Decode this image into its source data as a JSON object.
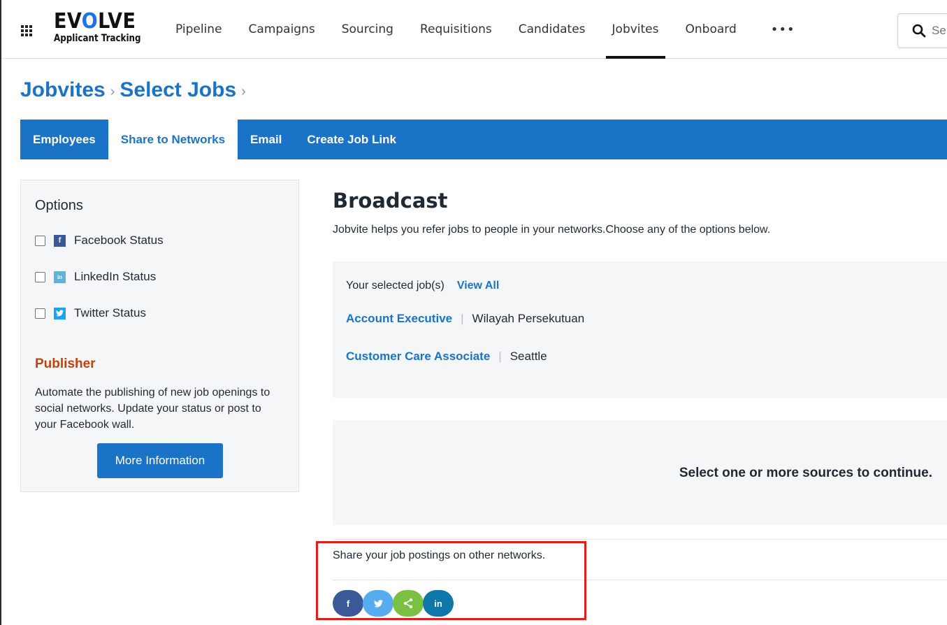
{
  "app": {
    "logo_text": "EVOLVE",
    "logo_subtitle": "Applicant Tracking"
  },
  "nav": {
    "items": [
      "Pipeline",
      "Campaigns",
      "Sourcing",
      "Requisitions",
      "Candidates",
      "Jobvites",
      "Onboard"
    ],
    "active": "Jobvites",
    "more_label": "•••",
    "search_placeholder": "Se"
  },
  "breadcrumb": {
    "items": [
      "Jobvites",
      "Select Jobs"
    ],
    "separator": "›"
  },
  "tabs": {
    "items": [
      "Employees",
      "Share to Networks",
      "Email",
      "Create Job Link"
    ],
    "active": "Share to Networks"
  },
  "options": {
    "title": "Options",
    "items": [
      {
        "label": "Facebook Status",
        "icon": "facebook-icon",
        "color": "#3b5998",
        "glyph": "f"
      },
      {
        "label": "LinkedIn Status",
        "icon": "linkedin-icon",
        "color": "#5fb3d9",
        "glyph": "in"
      },
      {
        "label": "Twitter Status",
        "icon": "twitter-icon",
        "color": "#1da1f2",
        "glyph": "t"
      }
    ],
    "publisher_title": "Publisher",
    "publisher_text": "Automate the publishing of new job openings to social networks. Update your status or post to your Facebook wall.",
    "more_button": "More Information"
  },
  "broadcast": {
    "title": "Broadcast",
    "description": "Jobvite helps you refer jobs to people in your networks.Choose any of the options below.",
    "selected_label": "Your selected job(s)",
    "view_all": "View All",
    "jobs": [
      {
        "title": "Account Executive",
        "location": "Wilayah Persekutuan"
      },
      {
        "title": "Customer Care Associate",
        "location": "Seattle"
      }
    ],
    "job_separator": "|",
    "sources_message": "Select one or more sources to continue.",
    "share_text": "Share your job postings on other networks.",
    "share_buttons": [
      {
        "icon": "facebook-icon",
        "color": "#3b5998",
        "glyph": "f"
      },
      {
        "icon": "twitter-icon",
        "color": "#55acee",
        "glyph": "t"
      },
      {
        "icon": "share-icon",
        "color": "#7ac143",
        "glyph": ""
      },
      {
        "icon": "linkedin-icon",
        "color": "#0e76a8",
        "glyph": "in"
      }
    ]
  },
  "colors": {
    "brand_blue": "#1b73c8",
    "publisher_orange": "#c2410c",
    "highlight_red": "#e11d1d"
  }
}
